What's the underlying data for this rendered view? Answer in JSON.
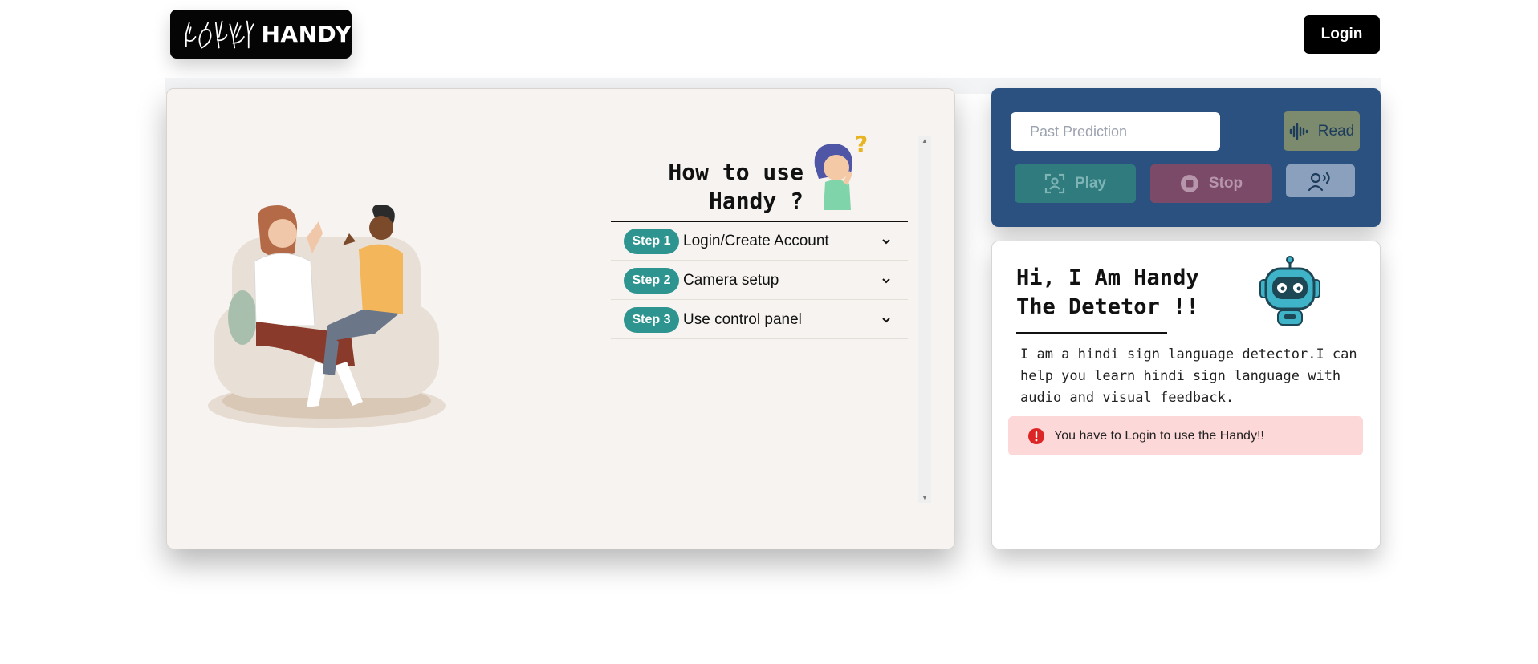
{
  "header": {
    "brand": "HANDY",
    "login_label": "Login"
  },
  "howto": {
    "title_line1": "How to use",
    "title_line2": "Handy ?",
    "steps": [
      {
        "badge": "Step 1",
        "label": "Login/Create Account"
      },
      {
        "badge": "Step 2",
        "label": "Camera setup"
      },
      {
        "badge": "Step 3",
        "label": "Use control panel"
      }
    ]
  },
  "control": {
    "past_placeholder": "Past Prediction",
    "read_label": "Read",
    "play_label": "Play",
    "stop_label": "Stop"
  },
  "info": {
    "title_line1": "Hi, I Am Handy",
    "title_line2": "The Detetor !!",
    "description": "I am a hindi sign language detector.I can help you learn hindi sign language with audio and visual feedback.",
    "alert": "You have to Login to use the Handy!!"
  },
  "colors": {
    "step_badge": "#2d9490",
    "control_panel": "#2b5180",
    "alert_bg": "#fdd8d8",
    "alert_icon": "#dc2626"
  },
  "icons": [
    "hand-signs-logo-icon",
    "sound-wave-icon",
    "camera-scan-icon",
    "stop-circle-icon",
    "speaking-person-icon",
    "chevron-down-icon",
    "error-icon",
    "robot-icon",
    "thinking-girl-icon"
  ]
}
